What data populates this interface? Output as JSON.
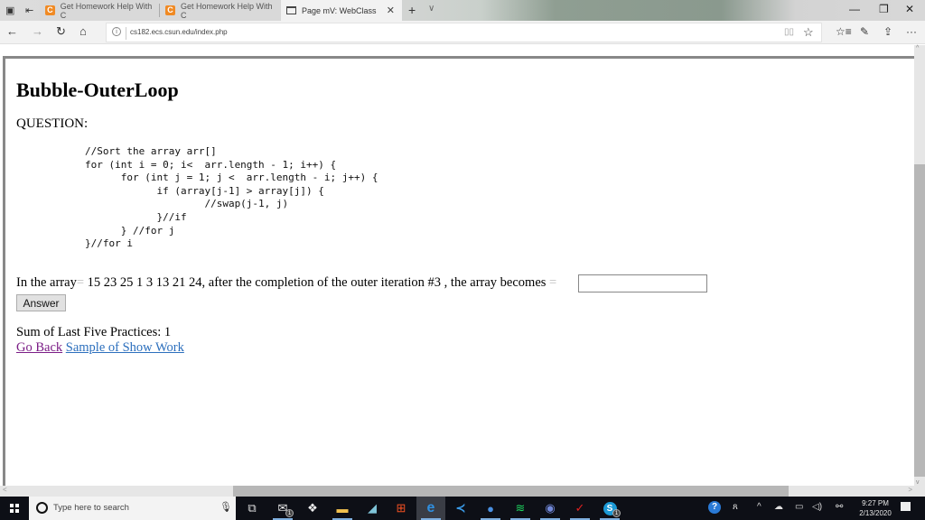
{
  "browser": {
    "tabs": [
      {
        "title": "Get Homework Help With C",
        "favicon": "chegg-c-icon",
        "active": false
      },
      {
        "title": "Get Homework Help With C",
        "favicon": "chegg-c-icon",
        "active": false
      },
      {
        "title": "Page mV: WebClass",
        "favicon": "page-icon",
        "active": true
      }
    ],
    "new_tab_glyph": "+",
    "tab_list_glyph": "∨",
    "close_tab_glyph": "✕",
    "window_controls": {
      "minimize": "—",
      "maximize": "❐",
      "close": "✕"
    },
    "nav": {
      "back": "←",
      "forward": "→",
      "refresh": "↻",
      "home": "⌂"
    },
    "url": "cs182.ecs.csun.edu/index.php",
    "info_glyph": "i",
    "reading_view_glyph": "▯▯",
    "favorite_glyph": "☆",
    "toolbar": {
      "favorites_hub": "☆≡",
      "notes": "✎",
      "share": "⇪",
      "more": "···"
    }
  },
  "page": {
    "title": "Bubble-OuterLoop",
    "question_label": "QUESTION:",
    "code": "//Sort the array arr[]\nfor (int i = 0; i<  arr.length - 1; i++) {\n      for (int j = 1; j <  arr.length - i; j++) {\n            if (array[j-1] > array[j]) {\n                    //swap(j-1, j)\n            }//if\n      } //for j\n}//for i",
    "prompt_prefix": "In the array",
    "equals_sign": "=",
    "array_values": "15 23 25 1 3 13 21 24",
    "prompt_middle": ", after the completion of the outer iteration #3 , the array becomes",
    "answer_value": "",
    "answer_button": "Answer",
    "sum_label": "Sum of Last Five Practices: 1",
    "links": {
      "go_back": "Go Back",
      "sample": "Sample of Show Work"
    }
  },
  "scrollbars": {
    "up": "^",
    "down": "v",
    "left": "<",
    "right": ">"
  },
  "taskbar": {
    "search_placeholder": "Type here to search",
    "apps": [
      {
        "name": "task-view",
        "glyph": "⧉"
      },
      {
        "name": "mail",
        "glyph": "✉",
        "badge": "1"
      },
      {
        "name": "dropbox",
        "glyph": "❖"
      },
      {
        "name": "file-explorer",
        "glyph": "▬"
      },
      {
        "name": "notes-app",
        "glyph": "◢"
      },
      {
        "name": "store",
        "glyph": "⊞"
      },
      {
        "name": "edge",
        "glyph": "e"
      },
      {
        "name": "visual-studio-code",
        "glyph": "≺"
      },
      {
        "name": "chrome",
        "glyph": "●"
      },
      {
        "name": "spotify",
        "glyph": "≋"
      },
      {
        "name": "discord",
        "glyph": "◉"
      },
      {
        "name": "trend-micro",
        "glyph": "✓"
      },
      {
        "name": "skype",
        "glyph": "S",
        "badge": "1"
      }
    ],
    "tray": {
      "help": "?",
      "people": "ጸ",
      "chevron": "^",
      "onedrive": "☁",
      "battery": "▭",
      "volume": "◁)",
      "network": "⚯"
    },
    "time": "9:27 PM",
    "date": "2/13/2020"
  }
}
